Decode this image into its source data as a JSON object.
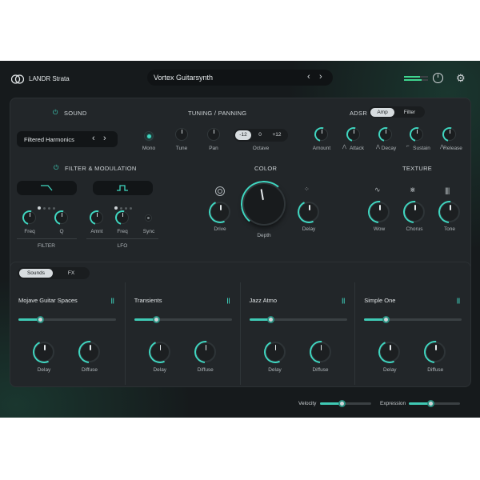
{
  "app": {
    "name": "LANDR Strata",
    "preset": "Vortex Guitarsynth"
  },
  "sound": {
    "header": "SOUND",
    "preset_name": "Filtered Harmonics",
    "controls": [
      {
        "label": "Mono"
      }
    ]
  },
  "tuning": {
    "header": "TUNING / PANNING",
    "tune_label": "Tune",
    "pan_label": "Pan",
    "octave_label": "Octave",
    "octave_options": [
      "-12",
      "0",
      "+12"
    ],
    "octave_selected": "-12"
  },
  "adsr": {
    "header": "ADSR",
    "tabs": [
      "Amp",
      "Filter"
    ],
    "selected_tab": "Amp",
    "knobs": [
      "Amount",
      "Attack",
      "Decay",
      "Sustain",
      "Release"
    ]
  },
  "filter_mod": {
    "header": "FILTER & MODULATION",
    "filter_knobs": [
      "Freq",
      "Q"
    ],
    "lfo_knobs": [
      "Amnt",
      "Freq",
      "Sync"
    ],
    "filter_label": "FILTER",
    "lfo_label": "LFO"
  },
  "color": {
    "header": "COLOR",
    "knobs": [
      "Drive",
      "Depth",
      "Delay"
    ]
  },
  "texture": {
    "header": "TEXTURE",
    "knobs": [
      "Wow",
      "Chorus",
      "Tone"
    ]
  },
  "bottom_tabs": {
    "tabs": [
      "Sounds",
      "FX"
    ],
    "selected": "Sounds"
  },
  "layers": [
    {
      "name": "Mojave Guitar Spaces",
      "slider": 0.22,
      "knobs": [
        "Delay",
        "Diffuse"
      ]
    },
    {
      "name": "Transients",
      "slider": 0.22,
      "knobs": [
        "Delay",
        "Diffuse"
      ]
    },
    {
      "name": "Jazz Atmo",
      "slider": 0.22,
      "knobs": [
        "Delay",
        "Diffuse"
      ]
    },
    {
      "name": "Simple One",
      "slider": 0.22,
      "knobs": [
        "Delay",
        "Diffuse"
      ]
    }
  ],
  "footer": {
    "velocity_label": "Velocity",
    "velocity_value": 0.42,
    "expression_label": "Expression",
    "expression_value": 0.42
  },
  "colors": {
    "accent": "#3fd6c0",
    "background": "#161a1c",
    "panel": "#222629"
  }
}
